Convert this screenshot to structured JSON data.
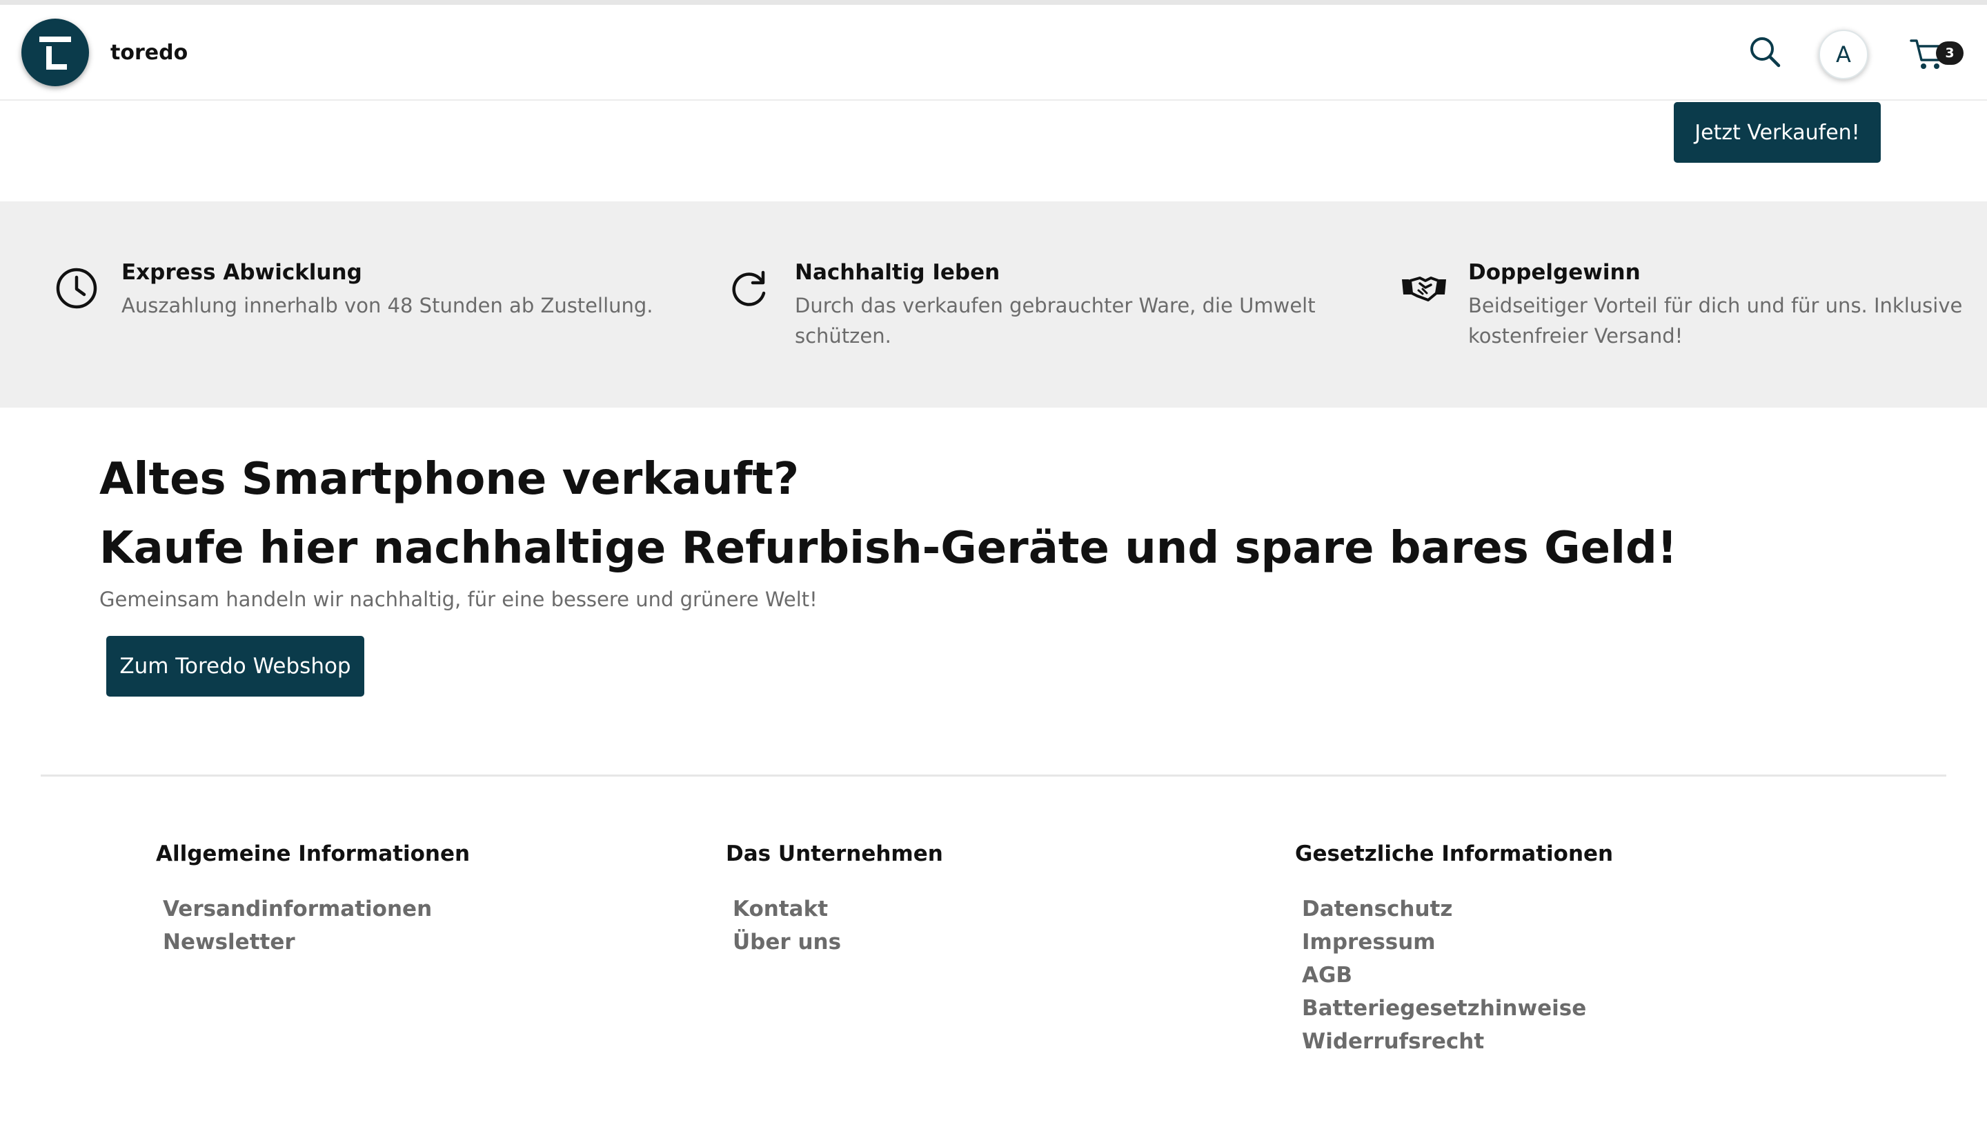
{
  "header": {
    "brand": "toredo",
    "account_initial": "A",
    "cart_count": "3",
    "sell_button": "Jetzt Verkaufen!"
  },
  "features": [
    {
      "icon": "clock-icon",
      "title": "Express Abwicklung",
      "text": "Auszahlung innerhalb von 48 Stunden ab Zustellung."
    },
    {
      "icon": "refresh-icon",
      "title": "Nachhaltig Ieben",
      "text": "Durch das verkaufen gebrauchter Ware, die Umwelt schützen."
    },
    {
      "icon": "handshake-icon",
      "title": "Doppelgewinn",
      "text": "Beidseitiger Vorteil für dich und für uns. Inklusive kostenfreier Versand!"
    }
  ],
  "hero": {
    "line1": "Altes Smartphone verkauft?",
    "line2": "Kaufe hier nachhaltige Refurbish-Geräte und spare bares Geld!",
    "subtitle": "Gemeinsam handeln wir nachhaltig, für eine bessere und grünere Welt!",
    "button": "Zum Toredo Webshop"
  },
  "footer": {
    "columns": [
      {
        "title": "Allgemeine Informationen",
        "links": [
          "Versandinformationen",
          "Newsletter"
        ]
      },
      {
        "title": "Das Unternehmen",
        "links": [
          "Kontakt",
          "Über uns"
        ]
      },
      {
        "title": "Gesetzliche Informationen",
        "links": [
          "Datenschutz",
          "Impressum",
          "AGB",
          "Batteriegesetzhinweise",
          "Widerrufsrecht"
        ]
      }
    ]
  },
  "colors": {
    "primary": "#0b3b4b",
    "band_bg": "#efefef",
    "muted_text": "#6b6b6b"
  }
}
